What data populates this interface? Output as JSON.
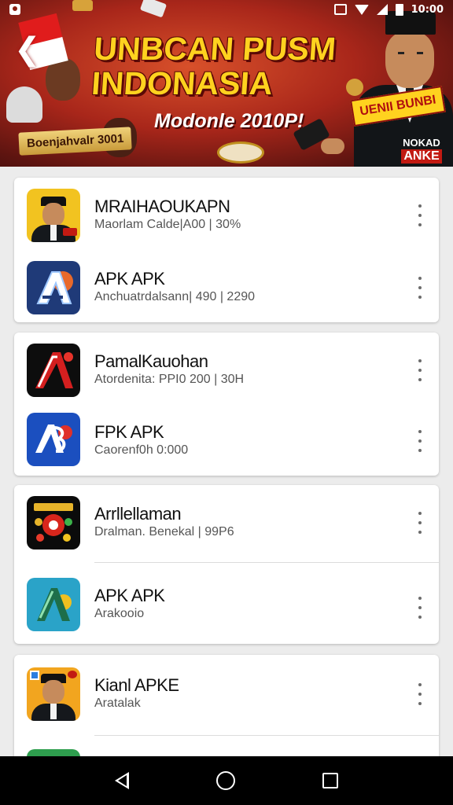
{
  "status_bar": {
    "time": "10:00"
  },
  "banner": {
    "title_line1": "UNBCAN PUSM",
    "title_line2": "INDONASIA",
    "subtitle": "Modonle 2010P!",
    "tag_left": "Boenjahvalr 3001",
    "tag_right": "UENII BUNBI",
    "corner_badge_line1": "NOKAD",
    "corner_badge_line2": "ANKE",
    "colors": {
      "title": "#ffd21f",
      "background": "#a8261a"
    }
  },
  "apps": [
    {
      "name": "MRAIHAOUKAPN",
      "meta": "Maorlam Calde|A00 | 30%",
      "icon": "person-portrait-icon"
    },
    {
      "name": "APK APK",
      "meta": "Anchuatrdalsann| 490 | 2290",
      "icon": "letter-a-blue-icon"
    },
    {
      "name": "PamalKauohan",
      "meta": "Atordenita: PPI0 200 | 30H",
      "icon": "letter-a-black-red-icon"
    },
    {
      "name": "FPK APK",
      "meta": "Caorenf0h 0:000",
      "icon": "letter-a-blue-sticker-icon"
    },
    {
      "name": "Arrllellaman",
      "meta": "Dralman.  Benekal  | 99P6",
      "icon": "casino-logo-icon"
    },
    {
      "name": "APK APK",
      "meta": "Arakooio",
      "icon": "letter-a-teal-icon"
    },
    {
      "name": "Kianl APKE",
      "meta": "Aratalak",
      "icon": "person-portrait-icon"
    }
  ],
  "nav": {
    "back": "back",
    "home": "home",
    "recents": "recents"
  }
}
